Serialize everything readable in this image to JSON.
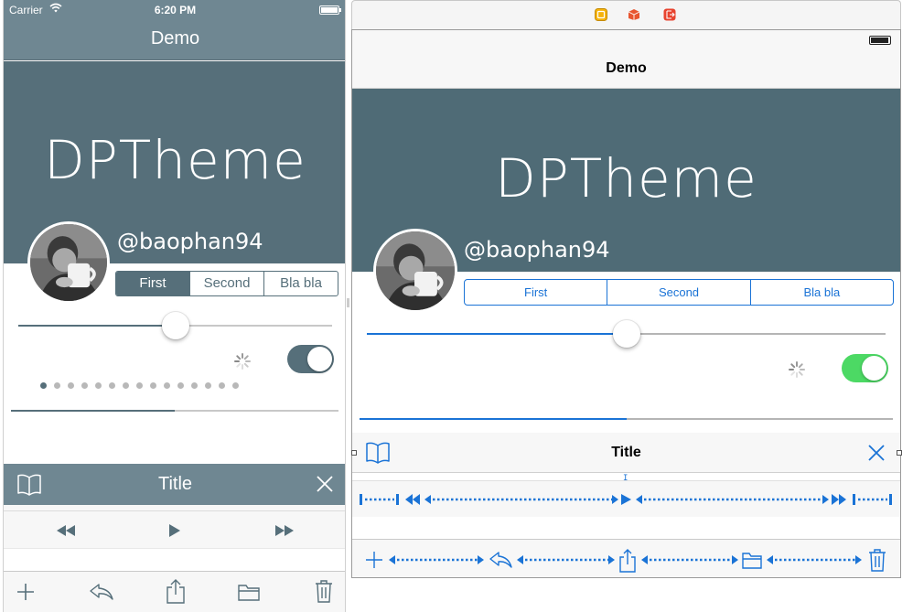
{
  "colors": {
    "left_theme": "#566f7a",
    "left_bar": "#6f8792",
    "right_tint": "#1a73d6",
    "right_hero": "#4f6b76",
    "switch_on": "#4cd964"
  },
  "simulator": {
    "status": {
      "carrier": "Carrier",
      "time": "6:20 PM"
    },
    "nav_title": "Demo",
    "hero_title": "DPTheme",
    "username": "@baophan94",
    "segments": [
      "First",
      "Second",
      "Bla bla"
    ],
    "selected_segment": "First",
    "slider_value": 0.5,
    "switch_on": true,
    "page_count": 15,
    "current_page": 1,
    "progress": 0.5,
    "navbar2": {
      "title": "Title",
      "left_icon": "bookmarks-icon",
      "right_icon": "close-icon"
    },
    "toolbar1": [
      "rewind-icon",
      "play-icon",
      "fast-forward-icon"
    ],
    "toolbar2": [
      "add-icon",
      "reply-icon",
      "share-icon",
      "folder-icon",
      "trash-icon"
    ]
  },
  "interface_builder": {
    "dock_icons": [
      "view-controller-icon",
      "first-responder-icon",
      "exit-icon"
    ],
    "nav_title": "Demo",
    "hero_title": "DPTheme",
    "username": "@baophan94",
    "segments": [
      "First",
      "Second",
      "Bla bla"
    ],
    "slider_value": 0.5,
    "switch_on": true,
    "progress": 0.5,
    "navbar2": {
      "title": "Title",
      "left_icon": "bookmarks-icon",
      "right_icon": "close-icon"
    },
    "toolbar1": [
      "fixed-space",
      "rewind-icon",
      "flexible-space",
      "play-icon",
      "flexible-space",
      "fast-forward-icon",
      "fixed-space"
    ],
    "toolbar2": [
      "add-icon",
      "flexible-space",
      "reply-icon",
      "flexible-space",
      "share-icon",
      "flexible-space",
      "folder-icon",
      "flexible-space",
      "trash-icon"
    ]
  }
}
